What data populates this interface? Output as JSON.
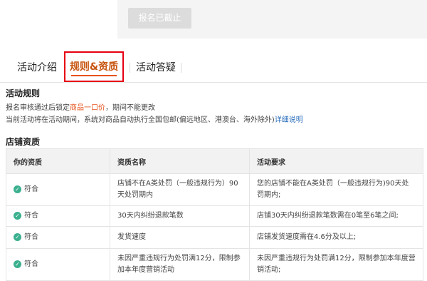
{
  "registration": {
    "closed_label": "报名已截止"
  },
  "tabs": [
    {
      "label": "活动介绍"
    },
    {
      "label": "规则&资质"
    },
    {
      "label": "活动答疑"
    }
  ],
  "rules": {
    "title": "活动规则",
    "line1_pre": "报名审核通过后锁定",
    "line1_hl": "商品一口价",
    "line1_post": "，期间不能更改",
    "line2_pre": "当前活动将在活动期间，系统对商品自动执行全国包邮(偏远地区、港澳台、海外除外)",
    "line2_link": "详细说明"
  },
  "qualification": {
    "title": "店铺资质",
    "headers": [
      "你的资质",
      "资质名称",
      "活动要求"
    ],
    "rows": [
      {
        "status": "符合",
        "name": "店铺不在A类处罚（一般违规行为）90天处罚期内",
        "requirement": "您的店铺不能在A类处罚（一般违规行为)90天处罚期内;"
      },
      {
        "status": "符合",
        "name": "30天内纠纷退款笔数",
        "requirement": "店铺30天内纠纷退款笔数需在0笔至6笔之间;"
      },
      {
        "status": "符合",
        "name": "发货速度",
        "requirement": "店铺发货速度需在4.6分及以上;"
      },
      {
        "status": "符合",
        "name": "未因严重违规行为处罚满12分，限制参加本年度营销活动",
        "requirement": "未因严重违规行为处罚满12分，限制参加本年度营销活动;"
      }
    ]
  }
}
